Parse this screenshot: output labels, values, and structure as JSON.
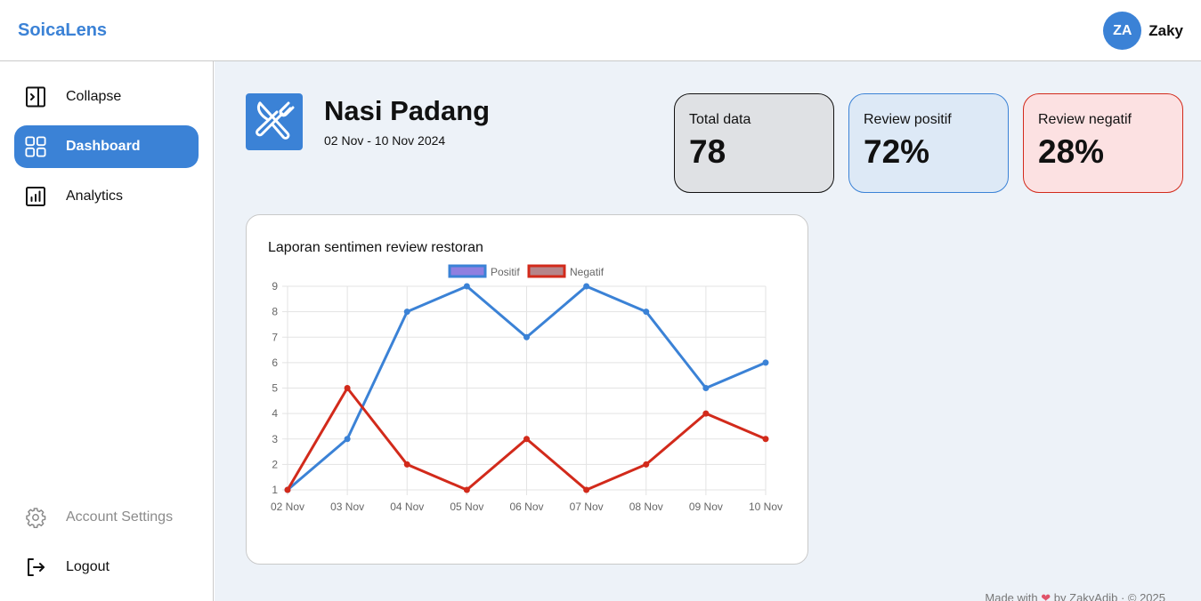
{
  "app": {
    "brand": "SoicaLens"
  },
  "user": {
    "initials": "ZA",
    "name": "Zaky"
  },
  "sidebar": {
    "items": [
      {
        "label": "Collapse",
        "icon": "collapse-icon"
      },
      {
        "label": "Dashboard",
        "icon": "dashboard-icon",
        "active": true
      },
      {
        "label": "Analytics",
        "icon": "analytics-icon"
      }
    ],
    "bottom": [
      {
        "label": "Account Settings",
        "icon": "gear-icon"
      },
      {
        "label": "Logout",
        "icon": "logout-icon"
      }
    ]
  },
  "menu": {
    "title": "Nasi Padang",
    "range": "02 Nov - 10 Nov 2024",
    "icon": "utensils-icon"
  },
  "stats": {
    "total_label": "Total data",
    "total_value": "78",
    "positive_label": "Review positif",
    "positive_value": "72%",
    "negative_label": "Review negatif",
    "negative_value": "28%"
  },
  "colors": {
    "accent": "#3b82d6",
    "positive": "#3b82d6",
    "negative": "#d22a1b",
    "background": "#edf2f8"
  },
  "chart_data": {
    "type": "line",
    "title": "Laporan sentimen review restoran",
    "categories": [
      "02 Nov",
      "03 Nov",
      "04 Nov",
      "05 Nov",
      "06 Nov",
      "07 Nov",
      "08 Nov",
      "09 Nov",
      "10 Nov"
    ],
    "series": [
      {
        "name": "Positif",
        "values": [
          1,
          3,
          8,
          9,
          7,
          9,
          8,
          5,
          6
        ],
        "color": "#3b82d6"
      },
      {
        "name": "Negatif",
        "values": [
          1,
          5,
          2,
          1,
          3,
          1,
          2,
          4,
          3
        ],
        "color": "#d22a1b"
      }
    ],
    "yticks": [
      1,
      2,
      3,
      4,
      5,
      6,
      7,
      8,
      9
    ],
    "ylim": [
      1,
      9
    ],
    "grid": true,
    "legend": "top"
  },
  "footer": {
    "before": "Made with",
    "after": "by ZakyAdib · © 2025"
  }
}
